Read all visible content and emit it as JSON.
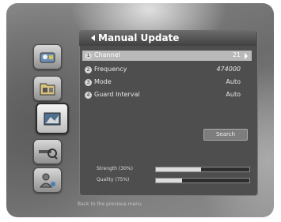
{
  "window": {
    "title": "Manual Update"
  },
  "sidebar": {
    "items": [
      {
        "icon": "satellite-dish-icon",
        "active": false
      },
      {
        "icon": "media-folder-icon",
        "active": false
      },
      {
        "icon": "installation-icon",
        "active": true
      },
      {
        "icon": "search-key-icon",
        "active": false
      },
      {
        "icon": "settings-person-icon",
        "active": false
      }
    ]
  },
  "settings": [
    {
      "number": "1",
      "label": "Channel",
      "value": "21",
      "selected": true
    },
    {
      "number": "2",
      "label": "Frequency",
      "value": "474000",
      "selected": false
    },
    {
      "number": "3",
      "label": "Mode",
      "value": "Auto",
      "selected": false
    },
    {
      "number": "4",
      "label": "Guard Interval",
      "value": "Auto",
      "selected": false
    }
  ],
  "search_button": {
    "label": "Search"
  },
  "meters": {
    "strength": {
      "label": "Strength",
      "percent_text": "(30%)",
      "level": 0.48
    },
    "quality": {
      "label": "Quality",
      "percent_text": "(75%)",
      "level": 0.28
    }
  },
  "status": {
    "text": "Back to the previous menu"
  }
}
